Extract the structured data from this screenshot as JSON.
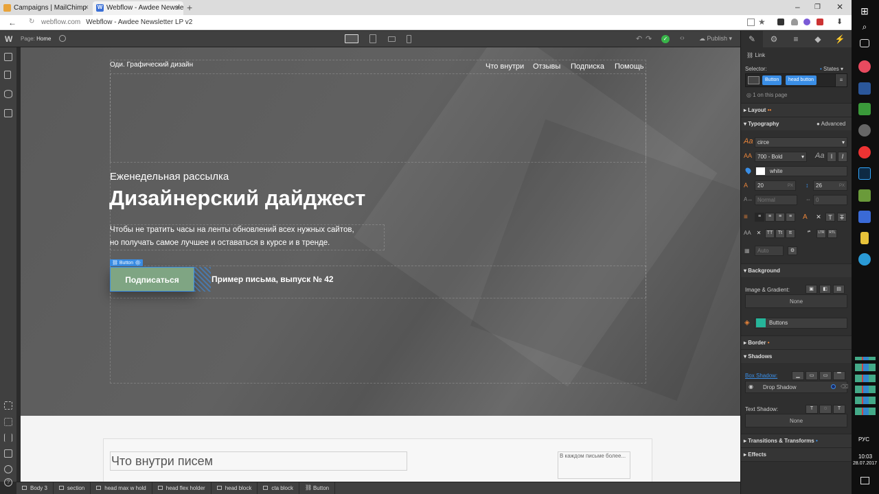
{
  "browser": {
    "tabs": [
      {
        "title": "Campaigns | MailChimp"
      },
      {
        "title": "Webflow - Awdee Newsle"
      }
    ],
    "url_host": "webflow.com",
    "url_title": "Webflow - Awdee Newsletter LP v2"
  },
  "designer": {
    "page_label": "Page:",
    "page_name": "Home",
    "publish": "Publish"
  },
  "site": {
    "brand": "Оди. Графический дизайн",
    "nav": [
      "Что внутри",
      "Отзывы",
      "Подписка",
      "Помощь"
    ],
    "subtitle": "Еженедельная рассылка",
    "title": "Дизайнерский дайджест",
    "desc_line1": "Чтобы не тратить часы на ленты обновлений всех нужных сайтов,",
    "desc_line2": "но получать самое лучшее и оставаться в курсе и в тренде.",
    "selected_tag": "Button",
    "cta": "Подписаться",
    "sample_link": "Пример письма, выпуск № 42",
    "section_title": "Что внутри писем",
    "aside_text": "В каждом письме более..."
  },
  "panel": {
    "element_type": "Link",
    "selector_label": "Selector:",
    "states": "States",
    "chips": [
      "Button",
      "head button"
    ],
    "on_page": "1 on this page",
    "sections": {
      "layout": "Layout",
      "typography": "Typography",
      "advanced": "Advanced",
      "background": "Background",
      "border": "Border",
      "shadows": "Shadows",
      "transitions": "Transitions & Transforms",
      "effects": "Effects"
    },
    "font": "circe",
    "weight": "700 - Bold",
    "color_name": "white",
    "font_size": "20",
    "line_height": "26",
    "unit": "PX",
    "letter_spacing": "Normal",
    "word_spacing": "0",
    "columns": "Auto",
    "image_gradient_label": "Image & Gradient:",
    "none": "None",
    "bg_swatch": "Buttons",
    "box_shadow": "Box Shadow:",
    "drop_shadow": "Drop Shadow",
    "text_shadow": "Text Shadow:",
    "text_shadow_none": "None"
  },
  "breadcrumbs": [
    "Body 3",
    "section",
    "head max w hold",
    "head flex holder",
    "head block",
    "cta block",
    "Button"
  ],
  "taskbar": {
    "lang": "РУС",
    "time": "10:03",
    "date": "28.07.2017"
  },
  "colors": {
    "cta": "#7fa583",
    "selection": "#3a8ee6",
    "accent_orange": "#e8843a",
    "teal": "#26b59a"
  }
}
